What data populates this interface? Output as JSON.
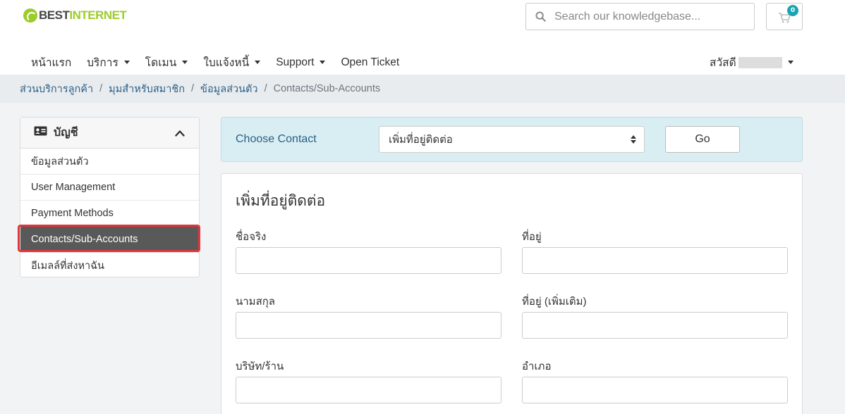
{
  "brand": {
    "name_part1": "BEST",
    "name_part2": "INTERNET"
  },
  "search": {
    "placeholder": "Search our knowledgebase..."
  },
  "cart": {
    "count": "0"
  },
  "nav": {
    "items": [
      {
        "label": "หน้าแรก",
        "dropdown": false
      },
      {
        "label": "บริการ",
        "dropdown": true
      },
      {
        "label": "โดเมน",
        "dropdown": true
      },
      {
        "label": "ใบแจ้งหนี้",
        "dropdown": true
      },
      {
        "label": "Support",
        "dropdown": true
      },
      {
        "label": "Open Ticket",
        "dropdown": false
      }
    ],
    "greeting": "สวัสดี"
  },
  "breadcrumb": {
    "links": [
      "ส่วนบริการลูกค้า",
      "มุมสำหรับสมาชิก",
      "ข้อมูลส่วนตัว"
    ],
    "current": "Contacts/Sub-Accounts",
    "separator": "/"
  },
  "sidebar": {
    "title": "บัญชี",
    "items": [
      {
        "label": "ข้อมูลส่วนตัว",
        "active": false
      },
      {
        "label": "User Management",
        "active": false
      },
      {
        "label": "Payment Methods",
        "active": false
      },
      {
        "label": "Contacts/Sub-Accounts",
        "active": true
      },
      {
        "label": "อีเมลล์ที่ส่งหาฉัน",
        "active": false
      }
    ]
  },
  "choose_contact": {
    "label": "Choose Contact",
    "selected": "เพิ่มที่อยู่ติดต่อ",
    "go_label": "Go"
  },
  "form": {
    "title": "เพิ่มที่อยู่ติดต่อ",
    "fields": [
      {
        "label": "ชื่อจริง",
        "value": ""
      },
      {
        "label": "ที่อยู่",
        "value": ""
      },
      {
        "label": "นามสกุล",
        "value": ""
      },
      {
        "label": "ที่อยู่ (เพิ่มเติม)",
        "value": ""
      },
      {
        "label": "บริษัท/ร้าน",
        "value": ""
      },
      {
        "label": "อำเภอ",
        "value": ""
      }
    ]
  },
  "colors": {
    "brand_green": "#9ccc2b",
    "link_blue": "#2b5f86",
    "badge_teal": "#1aa4b3",
    "active_item": "#595959",
    "highlight_red": "#e0363c",
    "choose_bg": "#d9eef3"
  }
}
